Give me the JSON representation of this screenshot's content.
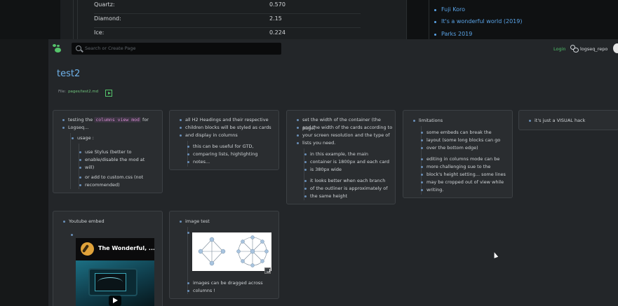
{
  "background_window": {
    "table_rows": [
      {
        "name": "Quartz:",
        "value": "0.570"
      },
      {
        "name": "Diamond:",
        "value": "2.15"
      },
      {
        "name": "Ice:",
        "value": "0.224"
      }
    ],
    "links": [
      "Fuji Koro",
      "It's a wonderful world (2019)",
      "Parks 2019"
    ]
  },
  "header": {
    "search_placeholder": "Search or Create Page",
    "login_label": "Login",
    "repo_label": "logseq_repo"
  },
  "page": {
    "title": "test2",
    "file_label": "File:",
    "file_path": "pages/test2.md"
  },
  "cards": {
    "c1": {
      "block1_before": "testing the ",
      "block1_code": "columns view mod",
      "block1_after": " for",
      "block1_line2": "Logseq...",
      "usage": "usage :",
      "opt1_l1": "use Stylus (better to",
      "opt1_l2": "enable/disable the mod at",
      "opt1_l3": "will)",
      "opt2_l1": "or add to custom.css (not",
      "opt2_l2": "recommended)"
    },
    "c2": {
      "l1": "all H2 Headings and their respective",
      "l2": "children blocks will be styled as cards",
      "l3": "and display in columns",
      "c1": "this can be useful for GTD,",
      "c2": "comparing lists, highlighting",
      "c3": "notes..."
    },
    "c3": {
      "l1": "set the width of the container (the page)",
      "l2": "and the width of the cards according to",
      "l3": "your screen resolution and the type of",
      "l4": "lists you need.",
      "a1": "in this example, the main",
      "a2": "container is 1800px and each card",
      "a3": "is 380px wide",
      "b1": "it looks better when each branch",
      "b2": "of the outliner is approximately of",
      "b3": "the same height"
    },
    "c4": {
      "title": "limitations",
      "a1": "some embeds can break the",
      "a2": "layout (some long blocks can go",
      "a3": "over the bottom edge)",
      "b1": "editing in columns mode can be",
      "b2": "more challenging sue to the",
      "b3": "block's height setting... some lines",
      "b4": "may be cropped out of view while",
      "b5": "writing."
    },
    "c5": {
      "l1": "it's just a VISUAL hack"
    },
    "c6": {
      "title": "Youtube embed",
      "video_title": "The Wonderful, ..."
    },
    "c7": {
      "title": "image test",
      "caption_l1": "images can be dragged across",
      "caption_l2": "columns !"
    }
  },
  "icons": [
    "logseq-logo-icon",
    "search-icon",
    "github-icon",
    "play-icon",
    "resize-handle-icon"
  ],
  "colors": {
    "accent_green": "#55c46b",
    "link_blue": "#6fb2ea",
    "card_bg": "#2a2d30"
  }
}
